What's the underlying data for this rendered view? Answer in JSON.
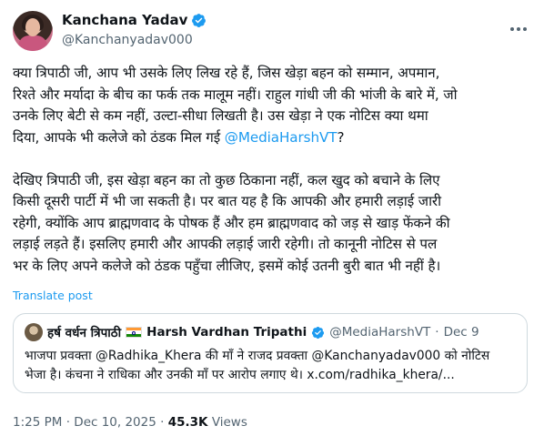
{
  "author": {
    "name": "Kanchana Yadav",
    "handle": "@Kanchanyadav000",
    "verified": true
  },
  "tweet": {
    "para1_part1": "क्या त्रिपाठी जी, आप भी उसके लिए लिख रहे हैं, जिस खेड़ा बहन को सम्मान, अपमान,\nरिश्ते और मर्यादा के बीच का फर्क तक मालूम नहीं। राहुल गांधी जी की भांजी के बारे में, जो\nउनके लिए बेटी से कम नहीं, उल्टा-सीधा लिखती है। उस खेड़ा ने एक नोटिस क्या थमा\nदिया, आपके भी कलेजे को ठंडक मिल गई ",
    "mention": "@MediaHarshVT",
    "para1_end": "?",
    "para2": "देखिए त्रिपाठी जी, इस खेड़ा बहन का तो कुछ ठिकाना नहीं, कल खुद को बचाने के लिए\nकिसी दूसरी पार्टी में भी जा सकती है। पर बात यह है कि आपकी और हमारी लड़ाई जारी\nरहेगी, क्योंकि आप ब्राह्मणवाद के पोषक हैं और हम ब्राह्मणवाद को जड़ से खाड़ फेंकने की\nलड़ाई लड़ते हैं। इसलिए हमारी और आपकी लड़ाई जारी रहेगी। तो कानूनी नोटिस से पल\nभर के लिए अपने कलेजे को ठंडक पहुँचा लीजिए, इसमें कोई उतनी बुरी बात भी नहीं है।",
    "translate_label": "Translate post"
  },
  "quote": {
    "name_hindi": "हर्ष वर्धन त्रिपाठी",
    "name_english": "Harsh Vardhan Tripathi",
    "handle": "@MediaHarshVT",
    "date": "Dec 9",
    "text": "भाजपा प्रवक्ता @Radhika_Khera की माँ ने राजद प्रवक्ता @Kanchanyadav000 को नोटिस\nभेजा है। कंचना ने राधिका और उनकी माँ पर आरोप लगाए थे। x.com/radhika_khera/..."
  },
  "footer": {
    "time": "1:25 PM",
    "date": "Dec 10, 2025",
    "views": "45.3K",
    "views_label": "Views"
  },
  "colors": {
    "accent": "#1d9bf0",
    "secondary_text": "#536471",
    "border": "#cfd9de"
  },
  "icons": [
    "verified-badge-icon",
    "more-options-icon",
    "india-flag-icon"
  ]
}
